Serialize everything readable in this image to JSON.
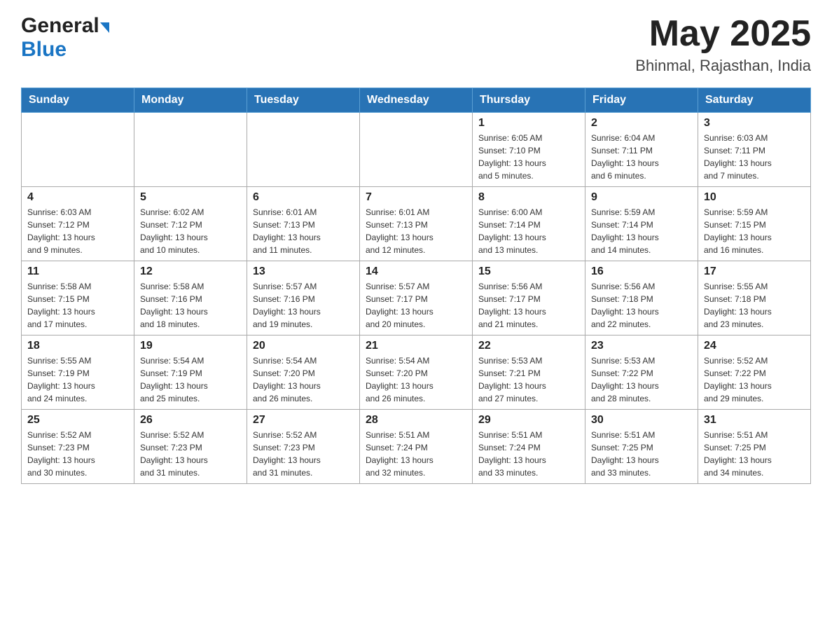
{
  "header": {
    "logo_general": "General",
    "logo_blue": "Blue",
    "main_title": "May 2025",
    "subtitle": "Bhinmal, Rajasthan, India"
  },
  "weekdays": [
    "Sunday",
    "Monday",
    "Tuesday",
    "Wednesday",
    "Thursday",
    "Friday",
    "Saturday"
  ],
  "weeks": [
    [
      {
        "day": "",
        "info": ""
      },
      {
        "day": "",
        "info": ""
      },
      {
        "day": "",
        "info": ""
      },
      {
        "day": "",
        "info": ""
      },
      {
        "day": "1",
        "info": "Sunrise: 6:05 AM\nSunset: 7:10 PM\nDaylight: 13 hours\nand 5 minutes."
      },
      {
        "day": "2",
        "info": "Sunrise: 6:04 AM\nSunset: 7:11 PM\nDaylight: 13 hours\nand 6 minutes."
      },
      {
        "day": "3",
        "info": "Sunrise: 6:03 AM\nSunset: 7:11 PM\nDaylight: 13 hours\nand 7 minutes."
      }
    ],
    [
      {
        "day": "4",
        "info": "Sunrise: 6:03 AM\nSunset: 7:12 PM\nDaylight: 13 hours\nand 9 minutes."
      },
      {
        "day": "5",
        "info": "Sunrise: 6:02 AM\nSunset: 7:12 PM\nDaylight: 13 hours\nand 10 minutes."
      },
      {
        "day": "6",
        "info": "Sunrise: 6:01 AM\nSunset: 7:13 PM\nDaylight: 13 hours\nand 11 minutes."
      },
      {
        "day": "7",
        "info": "Sunrise: 6:01 AM\nSunset: 7:13 PM\nDaylight: 13 hours\nand 12 minutes."
      },
      {
        "day": "8",
        "info": "Sunrise: 6:00 AM\nSunset: 7:14 PM\nDaylight: 13 hours\nand 13 minutes."
      },
      {
        "day": "9",
        "info": "Sunrise: 5:59 AM\nSunset: 7:14 PM\nDaylight: 13 hours\nand 14 minutes."
      },
      {
        "day": "10",
        "info": "Sunrise: 5:59 AM\nSunset: 7:15 PM\nDaylight: 13 hours\nand 16 minutes."
      }
    ],
    [
      {
        "day": "11",
        "info": "Sunrise: 5:58 AM\nSunset: 7:15 PM\nDaylight: 13 hours\nand 17 minutes."
      },
      {
        "day": "12",
        "info": "Sunrise: 5:58 AM\nSunset: 7:16 PM\nDaylight: 13 hours\nand 18 minutes."
      },
      {
        "day": "13",
        "info": "Sunrise: 5:57 AM\nSunset: 7:16 PM\nDaylight: 13 hours\nand 19 minutes."
      },
      {
        "day": "14",
        "info": "Sunrise: 5:57 AM\nSunset: 7:17 PM\nDaylight: 13 hours\nand 20 minutes."
      },
      {
        "day": "15",
        "info": "Sunrise: 5:56 AM\nSunset: 7:17 PM\nDaylight: 13 hours\nand 21 minutes."
      },
      {
        "day": "16",
        "info": "Sunrise: 5:56 AM\nSunset: 7:18 PM\nDaylight: 13 hours\nand 22 minutes."
      },
      {
        "day": "17",
        "info": "Sunrise: 5:55 AM\nSunset: 7:18 PM\nDaylight: 13 hours\nand 23 minutes."
      }
    ],
    [
      {
        "day": "18",
        "info": "Sunrise: 5:55 AM\nSunset: 7:19 PM\nDaylight: 13 hours\nand 24 minutes."
      },
      {
        "day": "19",
        "info": "Sunrise: 5:54 AM\nSunset: 7:19 PM\nDaylight: 13 hours\nand 25 minutes."
      },
      {
        "day": "20",
        "info": "Sunrise: 5:54 AM\nSunset: 7:20 PM\nDaylight: 13 hours\nand 26 minutes."
      },
      {
        "day": "21",
        "info": "Sunrise: 5:54 AM\nSunset: 7:20 PM\nDaylight: 13 hours\nand 26 minutes."
      },
      {
        "day": "22",
        "info": "Sunrise: 5:53 AM\nSunset: 7:21 PM\nDaylight: 13 hours\nand 27 minutes."
      },
      {
        "day": "23",
        "info": "Sunrise: 5:53 AM\nSunset: 7:22 PM\nDaylight: 13 hours\nand 28 minutes."
      },
      {
        "day": "24",
        "info": "Sunrise: 5:52 AM\nSunset: 7:22 PM\nDaylight: 13 hours\nand 29 minutes."
      }
    ],
    [
      {
        "day": "25",
        "info": "Sunrise: 5:52 AM\nSunset: 7:23 PM\nDaylight: 13 hours\nand 30 minutes."
      },
      {
        "day": "26",
        "info": "Sunrise: 5:52 AM\nSunset: 7:23 PM\nDaylight: 13 hours\nand 31 minutes."
      },
      {
        "day": "27",
        "info": "Sunrise: 5:52 AM\nSunset: 7:23 PM\nDaylight: 13 hours\nand 31 minutes."
      },
      {
        "day": "28",
        "info": "Sunrise: 5:51 AM\nSunset: 7:24 PM\nDaylight: 13 hours\nand 32 minutes."
      },
      {
        "day": "29",
        "info": "Sunrise: 5:51 AM\nSunset: 7:24 PM\nDaylight: 13 hours\nand 33 minutes."
      },
      {
        "day": "30",
        "info": "Sunrise: 5:51 AM\nSunset: 7:25 PM\nDaylight: 13 hours\nand 33 minutes."
      },
      {
        "day": "31",
        "info": "Sunrise: 5:51 AM\nSunset: 7:25 PM\nDaylight: 13 hours\nand 34 minutes."
      }
    ]
  ]
}
